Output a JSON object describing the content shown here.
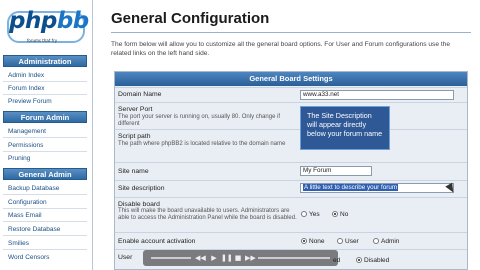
{
  "sidebar": {
    "logo_word": "php",
    "logo_word_b": "bb",
    "logo_tagline": "forums that fry",
    "sections": [
      {
        "title": "Administration",
        "items": [
          "Admin Index",
          "Forum Index",
          "Preview Forum"
        ]
      },
      {
        "title": "Forum Admin",
        "items": [
          "Management",
          "Permissions",
          "Pruning"
        ]
      },
      {
        "title": "General Admin",
        "items": [
          "Backup Database",
          "Configuration",
          "Mass Email",
          "Restore Database",
          "Smilies",
          "Word Censors"
        ]
      }
    ]
  },
  "main": {
    "title": "General Configuration",
    "intro": "The form below will allow you to customize all the general board options. For User and Forum configurations use the related links on the left hand side.",
    "panel_title": "General Board Settings",
    "fields": {
      "domain": {
        "label": "Domain Name",
        "value": "www.a33.net"
      },
      "port": {
        "label": "Server Port",
        "explain": "The port your server is running on, usually 80. Only change if different"
      },
      "script": {
        "label": "Script path",
        "explain": "The path where phpBB2 is located relative to the domain name"
      },
      "sitename": {
        "label": "Site name",
        "value": "My Forum"
      },
      "sitedesc": {
        "label": "Site description",
        "value": "A  little  text to describe your forum"
      },
      "disable": {
        "label": "Disable board",
        "explain": "This will make the board unavailable to users. Administrators are able to access the Administration Panel while the board is disabled.",
        "yes": "Yes",
        "no": "No"
      },
      "activation": {
        "label": "Enable account activation",
        "none": "None",
        "user": "User",
        "admin": "Admin"
      },
      "visual": {
        "label_partial": "User",
        "value_partial": "ed",
        "disabled": "Disabled"
      }
    }
  },
  "tooltip": {
    "text": "The Site Description will appear directly below your forum name"
  },
  "player": {
    "icons": [
      "rewind-icon",
      "play-icon",
      "pause-icon",
      "stop-icon",
      "forward-icon",
      "volume-icon"
    ]
  },
  "colors": {
    "accent": "#2e6aa3",
    "panel": "#e9eef4",
    "tooltip": "#2f5896"
  }
}
